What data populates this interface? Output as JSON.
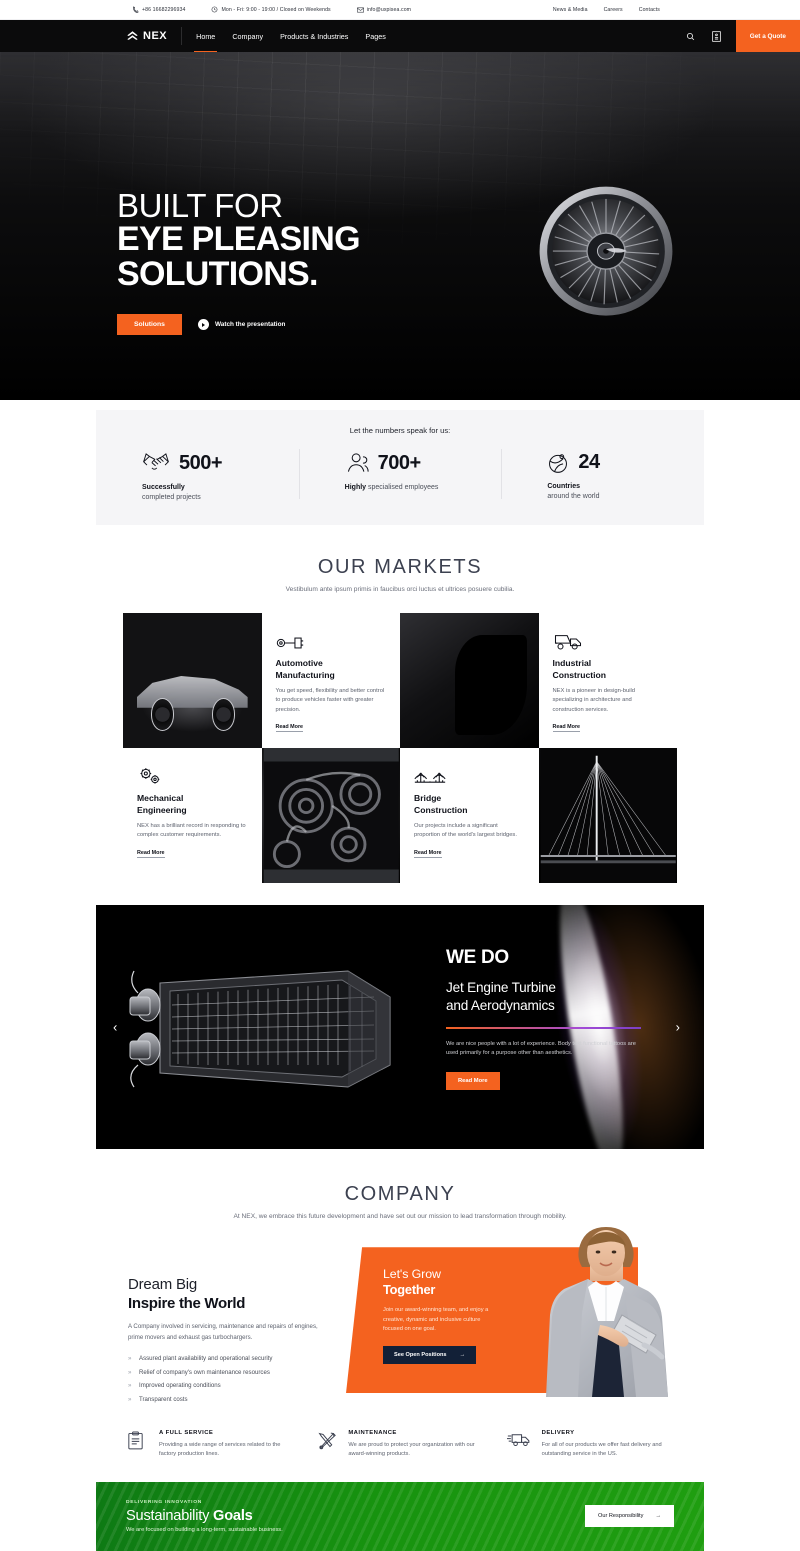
{
  "topbar": {
    "phone": "+86 16682296934",
    "hours": "Mon - Fri: 9:00 - 19:00 / Closed on Weekends",
    "email": "info@uxpisea.com",
    "links": [
      "News & Media",
      "Careers",
      "Contacts"
    ]
  },
  "nav": {
    "brand": "NEX",
    "items": [
      {
        "label": "Home",
        "active": true
      },
      {
        "label": "Company",
        "active": false
      },
      {
        "label": "Products & Industries",
        "active": false
      },
      {
        "label": "Pages",
        "active": false
      }
    ],
    "search_icon": "search-icon",
    "cart_icon": "cart-icon",
    "quote_label": "Get a Quote"
  },
  "hero": {
    "line1": "BUILT FOR",
    "line2": "EYE PLEASING",
    "line3": "SOLUTIONS.",
    "primary_button": "Solutions",
    "secondary_button": "Watch the presentation"
  },
  "stats": {
    "title": "Let the numbers speak for us:",
    "items": [
      {
        "icon": "handshake-icon",
        "number": "500+",
        "bold": "Successfully",
        "rest": "completed projects"
      },
      {
        "icon": "people-icon",
        "number": "700+",
        "bold": "Highly",
        "rest": " specialised employees"
      },
      {
        "icon": "globe-icon",
        "number": "24",
        "bold": "Countries",
        "rest": "around the world"
      }
    ]
  },
  "markets": {
    "title": "OUR MARKETS",
    "subtitle": "Vestibulum ante ipsum primis in faucibus orci luctus et ultrices posuere cubilia.",
    "cards": [
      {
        "icon": "piston-icon",
        "title_line1": "Automotive",
        "title_line2": "Manufacturing",
        "desc": "You get speed, flexibility and better control to produce vehicles faster with greater precision.",
        "more": "Read More"
      },
      {
        "icon": "dump-truck-icon",
        "title_line1": "Industrial",
        "title_line2": "Construction",
        "desc": "NEX is a pioneer in design-build specializing in architecture and construction services.",
        "more": "Read More"
      },
      {
        "icon": "gears-icon",
        "title_line1": "Mechanical",
        "title_line2": "Engineering",
        "desc": "NEX has a brilliant record in responding to complex customer requirements.",
        "more": "Read More"
      },
      {
        "icon": "bridge-icon",
        "title_line1": "Bridge",
        "title_line2": "Construction",
        "desc": "Our projects include a significant proportion of the world's largest bridges.",
        "more": "Read More"
      }
    ]
  },
  "wedo": {
    "kicker": "WE DO",
    "heading_line1": "Jet Engine Turbine",
    "heading_line2": "and Aerodynamics",
    "body": "We are nice people with a lot of experience. Body text functional tattoos are used primarily for a purpose other than aesthetics.",
    "button": "Read More",
    "prev_icon": "chevron-left-icon",
    "next_icon": "chevron-right-icon"
  },
  "company": {
    "title": "COMPANY",
    "subtitle": "At NEX, we embrace this future development and have set out our mission to lead transformation through mobility.",
    "left": {
      "heading_light": "Dream Big",
      "heading_bold": "Inspire the World",
      "paragraph": "A Company involved in servicing, maintenance and repairs of engines, prime movers and exhaust gas turbochargers.",
      "bullets": [
        "Assured plant availability and operational security",
        "Relief of company's own maintenance resources",
        "Improved operating conditions",
        "Transparent costs"
      ]
    },
    "panel": {
      "heading_light": "Let's Grow",
      "heading_bold": "Together",
      "paragraph": "Join our award-winning team, and enjoy a creative, dynamic and inclusive culture focused on one goal.",
      "button": "See Open Positions",
      "button_arrow": "→"
    }
  },
  "features": [
    {
      "icon": "clipboard-icon",
      "title": "A FULL SERVICE",
      "desc": "Providing a wide range of services related to the factory production lines."
    },
    {
      "icon": "tools-icon",
      "title": "MAINTENANCE",
      "desc": "We are proud to protect your organization with our award-winning products."
    },
    {
      "icon": "delivery-truck-icon",
      "title": "DELIVERY",
      "desc": "For all of our products we offer fast delivery and outstanding service in the US."
    }
  ],
  "sustainability": {
    "kicker": "DELIVERING INNOVATION",
    "title_light": "Sustainability ",
    "title_bold": "Goals",
    "subtitle": "We are focused on building a long-term, sustainable business.",
    "button": "Our Responsibility",
    "button_arrow": "→"
  },
  "colors": {
    "accent": "#f4621f",
    "dark": "#0b0b0c",
    "navy": "#122037",
    "green": "#17930f",
    "stats_bg": "#f5f5f7"
  }
}
